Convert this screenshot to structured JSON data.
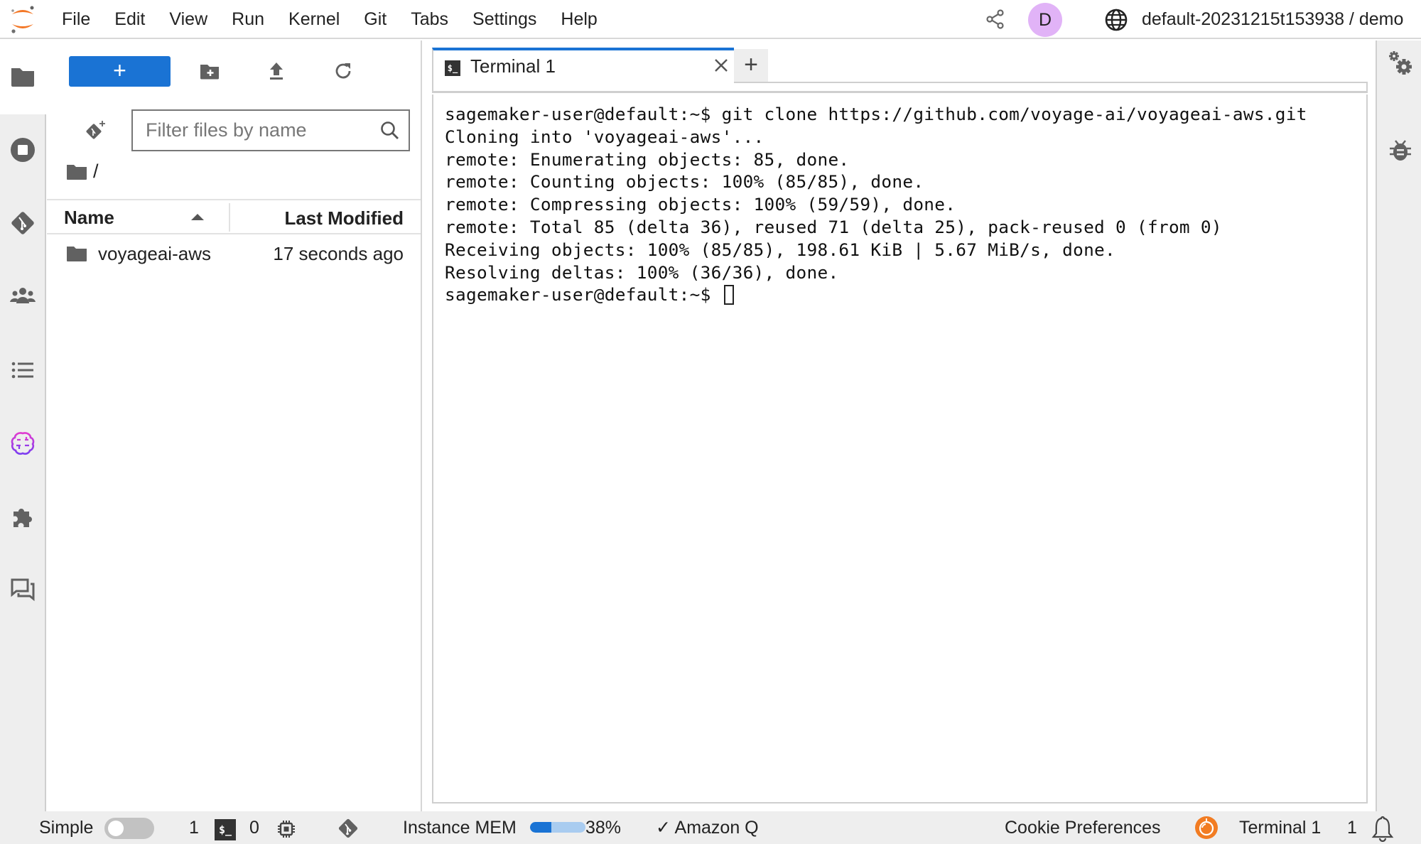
{
  "topbar": {
    "menu": [
      "File",
      "Edit",
      "View",
      "Run",
      "Kernel",
      "Git",
      "Tabs",
      "Settings",
      "Help"
    ],
    "avatar_initial": "D",
    "avatar_color": "#e1b3f7",
    "workspace": "default-20231215t153938 / demo"
  },
  "left_sidebar": {
    "items": [
      {
        "icon": "folder-icon",
        "label": "File Browser",
        "active": true
      },
      {
        "icon": "stop-circle-icon",
        "label": "Running Terminals and Kernels"
      },
      {
        "icon": "git-icon",
        "label": "Git"
      },
      {
        "icon": "users-icon",
        "label": "Collaboration"
      },
      {
        "icon": "list-icon",
        "label": "Table of Contents"
      },
      {
        "icon": "brain-icon",
        "label": "AI Assistant"
      },
      {
        "icon": "puzzle-icon",
        "label": "Extension Manager"
      },
      {
        "icon": "chat-icon",
        "label": "Chat"
      }
    ]
  },
  "file_browser": {
    "new_label": "+",
    "filter_placeholder": "Filter files by name",
    "filter_value": "",
    "breadcrumb": "/",
    "columns": {
      "name": "Name",
      "modified": "Last Modified"
    },
    "files": [
      {
        "name": "voyageai-aws",
        "type": "folder",
        "modified": "17 seconds ago"
      }
    ]
  },
  "main": {
    "tabs": [
      {
        "label": "Terminal 1",
        "icon": "$_",
        "active": true
      }
    ],
    "add_tab_label": "+",
    "terminal_lines": [
      "sagemaker-user@default:~$ git clone https://github.com/voyage-ai/voyageai-aws.git",
      "Cloning into 'voyageai-aws'...",
      "remote: Enumerating objects: 85, done.",
      "remote: Counting objects: 100% (85/85), done.",
      "remote: Compressing objects: 100% (59/59), done.",
      "remote: Total 85 (delta 36), reused 71 (delta 25), pack-reused 0 (from 0)",
      "Receiving objects: 100% (85/85), 198.61 KiB | 5.67 MiB/s, done.",
      "Resolving deltas: 100% (36/36), done."
    ],
    "prompt": "sagemaker-user@default:~$ "
  },
  "right_sidebar": {
    "items": [
      {
        "icon": "property-inspector-icon",
        "label": "Property Inspector"
      },
      {
        "icon": "debugger-icon",
        "label": "Debugger"
      }
    ]
  },
  "statusbar": {
    "simple_label": "Simple",
    "simple_mode": false,
    "terminals_count": "1",
    "terminal_icon": "$_",
    "kernels_count": "0",
    "mem_label": "Instance MEM",
    "mem_percent": 38,
    "mem_text": "38%",
    "amazon_q_label": "✓ Amazon Q",
    "cookie_label": "Cookie Preferences",
    "active_label": "Terminal 1",
    "notifications_count": "1",
    "accent_color": "#1a73d4"
  }
}
